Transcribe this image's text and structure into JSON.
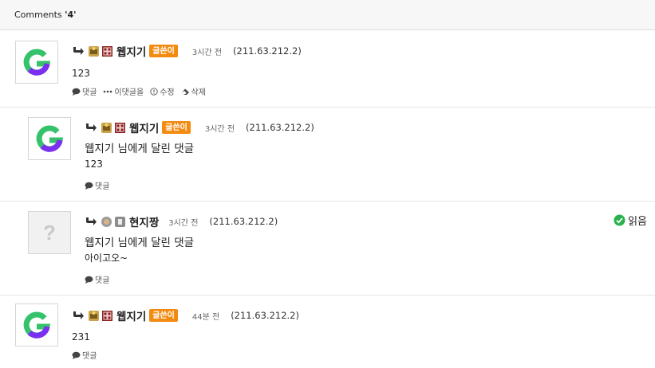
{
  "header": {
    "prefix": "Comments ",
    "count": "'4'"
  },
  "comments": [
    {
      "author": "웹지기",
      "badge": "글쓴이",
      "time": "3시간 전",
      "ip": "(211.63.212.2)",
      "text": "123",
      "actions": {
        "reply": "댓글",
        "more": "이댓글을",
        "edit": "수정",
        "delete": "삭제"
      }
    },
    {
      "author": "웹지기",
      "badge": "글쓴이",
      "time": "3시간 전",
      "ip": "(211.63.212.2)",
      "mention": "웹지기 님에게 달린 댓글",
      "text": "123",
      "actions": {
        "reply": "댓글"
      }
    },
    {
      "author": "현지짱",
      "time": "3시간 전",
      "ip": "(211.63.212.2)",
      "mention": "웹지기 님에게 달린 댓글",
      "text": "아이고오~",
      "status": "읽음",
      "avatar_placeholder": "?",
      "actions": {
        "reply": "댓글"
      }
    },
    {
      "author": "웹지기",
      "badge": "글쓴이",
      "time": "44분 전",
      "ip": "(211.63.212.2)",
      "text": "231",
      "actions": {
        "reply": "댓글"
      }
    }
  ],
  "colors": {
    "badge": "#f38b10",
    "read_check": "#2bb24c",
    "logo_green": "#34c26a",
    "logo_purple": "#7b2ff0"
  },
  "icons": [
    "reply-arrow-icon",
    "level-icon",
    "grade-icon",
    "comment-bubble-icon",
    "more-icon",
    "edit-icon",
    "delete-icon",
    "check-circle-icon",
    "g-logo-icon"
  ]
}
